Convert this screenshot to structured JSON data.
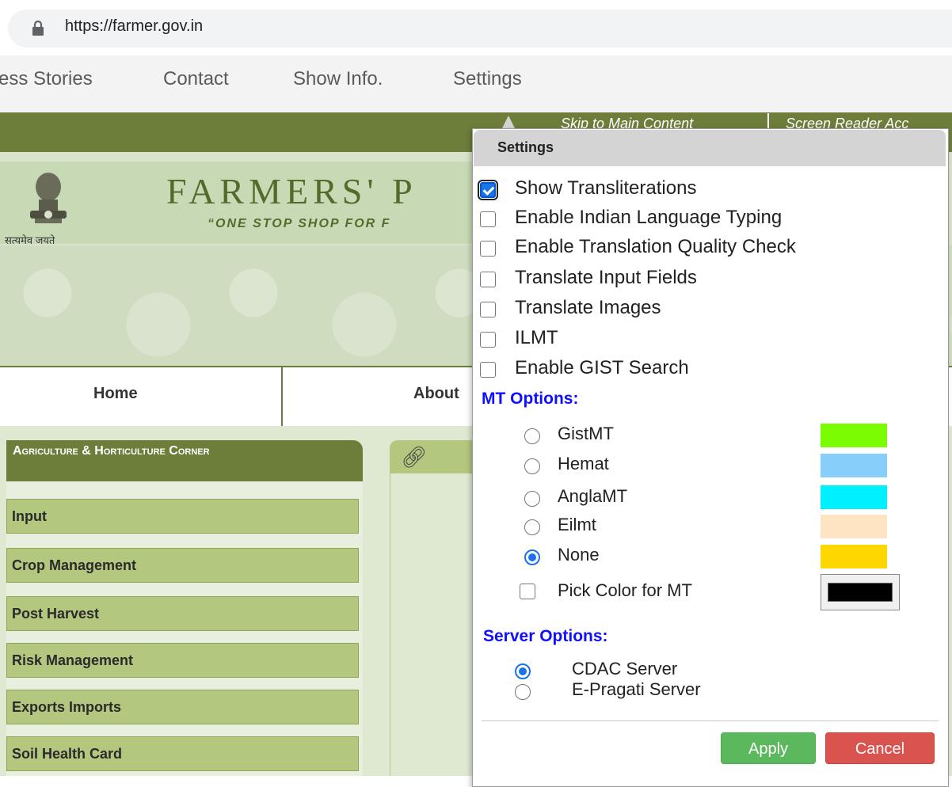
{
  "browser": {
    "url": "https://farmer.gov.in"
  },
  "extension_menu": {
    "items": [
      "ess Stories",
      "Contact",
      "Show Info.",
      "Settings"
    ]
  },
  "site": {
    "skip_link": "Skip to Main Content",
    "screen_reader": "Screen Reader Acc",
    "brand": "FARMERS' P",
    "tagline": "“ONE STOP SHOP FOR F",
    "emblem_motto": "सत्यमेव जयते",
    "nav": [
      "Home",
      "About"
    ],
    "corner_title": "Agriculture & Horticulture Corner",
    "sidebar": [
      "Input",
      "Crop Management",
      "Post Harvest",
      "Risk Management",
      "Exports Imports",
      "Soil Health Card"
    ],
    "panel_icon": "chain-link-icon"
  },
  "settings": {
    "title": "Settings",
    "options": [
      {
        "label": "Show Transliterations",
        "checked": true
      },
      {
        "label": "Enable Indian Language Typing",
        "checked": false
      },
      {
        "label": "Enable Translation Quality Check",
        "checked": false
      },
      {
        "label": "Translate Input Fields",
        "checked": false
      },
      {
        "label": "Translate Images",
        "checked": false
      },
      {
        "label": "ILMT",
        "checked": false
      },
      {
        "label": "Enable GIST Search",
        "checked": false
      }
    ],
    "mt_heading": "MT Options:",
    "mt_options": [
      {
        "label": "GistMT",
        "selected": false,
        "color": "#7cfc00"
      },
      {
        "label": "Hemat",
        "selected": false,
        "color": "#87cefa"
      },
      {
        "label": "AnglaMT",
        "selected": false,
        "color": "#00f0ff"
      },
      {
        "label": "Eilmt",
        "selected": false,
        "color": "#ffe4c4"
      },
      {
        "label": "None",
        "selected": true,
        "color": "#ffd700"
      }
    ],
    "pick_color_label": "Pick Color for MT",
    "pick_color_value": "#000000",
    "server_heading": "Server Options:",
    "servers": [
      {
        "label": "CDAC Server",
        "selected": true
      },
      {
        "label": "E-Pragati Server",
        "selected": false
      }
    ],
    "apply_label": "Apply",
    "cancel_label": "Cancel"
  }
}
